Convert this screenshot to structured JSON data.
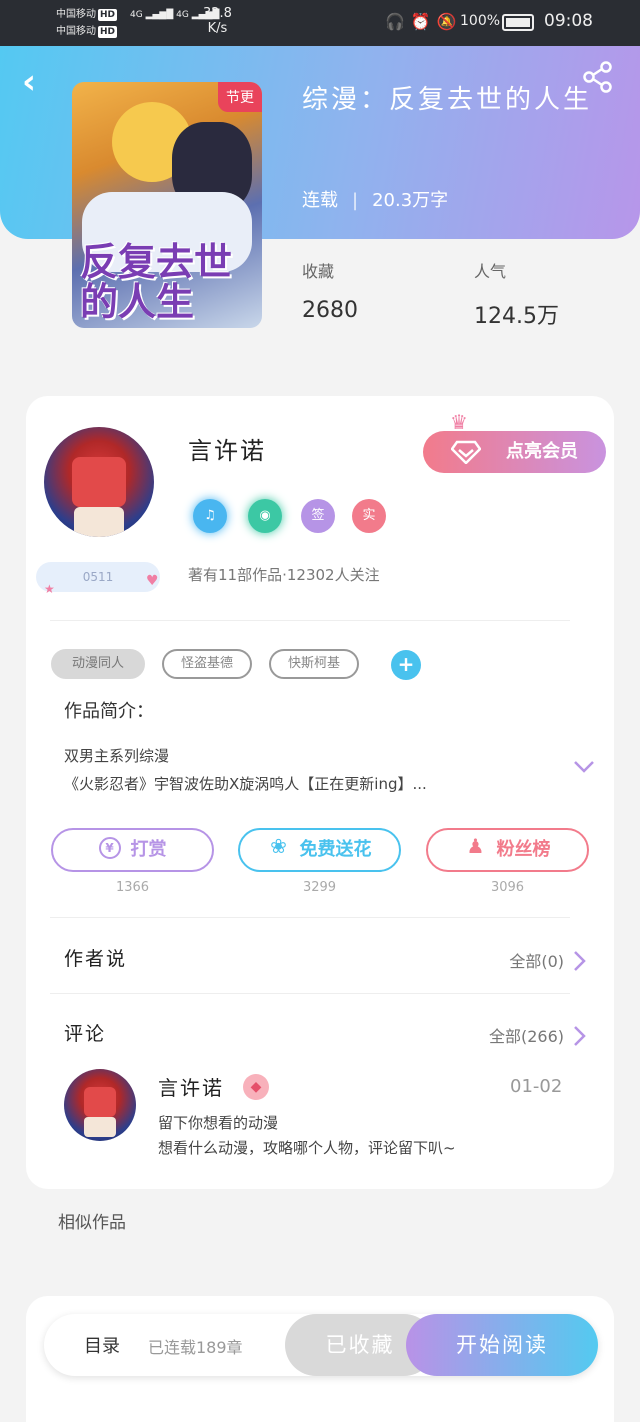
{
  "status_bar": {
    "carrier1": "中国移动",
    "carrier2": "中国移动",
    "hd": "HD",
    "net": "4G",
    "speed_value": "32.8",
    "speed_unit": "K/s",
    "battery": "100%",
    "time": "09:08"
  },
  "book": {
    "cover_badge": "节更",
    "cover_title": "反复去世的人生",
    "title": "综漫：反复去世的人生",
    "status": "连载",
    "words": "20.3万字",
    "stats": [
      {
        "label": "收藏",
        "value": "2680"
      },
      {
        "label": "人气",
        "value": "124.5万"
      }
    ]
  },
  "author": {
    "name": "言许诺",
    "uid": "0511",
    "vip_button": "点亮会员",
    "badges": [
      {
        "icon": "music-note-icon",
        "text": "♫",
        "color": "#49b6f0"
      },
      {
        "icon": "medal-icon",
        "text": "◉",
        "color": "#3cc8a4"
      },
      {
        "icon": "sign-icon",
        "text": "签",
        "color": "#b694e6"
      },
      {
        "icon": "real-icon",
        "text": "实",
        "color": "#f27b8b"
      }
    ],
    "works_info": "著有11部作品·12302人关注"
  },
  "tags": [
    "动漫同人",
    "怪盗基德",
    "快斯柯基"
  ],
  "intro": {
    "label": "作品简介：",
    "line1": "双男主系列综漫",
    "line2": "《火影忍者》宇智波佐助X旋涡鸣人【正在更新ing】..."
  },
  "actions": [
    {
      "label": "打赏",
      "count": "1366",
      "color": "#b694e6",
      "icon": "yen-icon",
      "glyph": "¥"
    },
    {
      "label": "免费送花",
      "count": "3299",
      "color": "#49c2ee",
      "icon": "flower-icon",
      "glyph": "❀"
    },
    {
      "label": "粉丝榜",
      "count": "3096",
      "color": "#f27b8b",
      "icon": "user-icon",
      "glyph": "♟"
    }
  ],
  "author_says": {
    "title": "作者说",
    "more": "全部(0)"
  },
  "comments": {
    "title": "评论",
    "more": "全部(266)",
    "item": {
      "name": "言许诺",
      "date": "01-02",
      "line1": "留下你想看的动漫",
      "line2": "想看什么动漫，攻略哪个人物，评论留下叭~"
    }
  },
  "similar": "相似作品",
  "bottom": {
    "toc": "目录",
    "chapters": "已连载189章",
    "collected": "已收藏",
    "read": "开始阅读"
  }
}
